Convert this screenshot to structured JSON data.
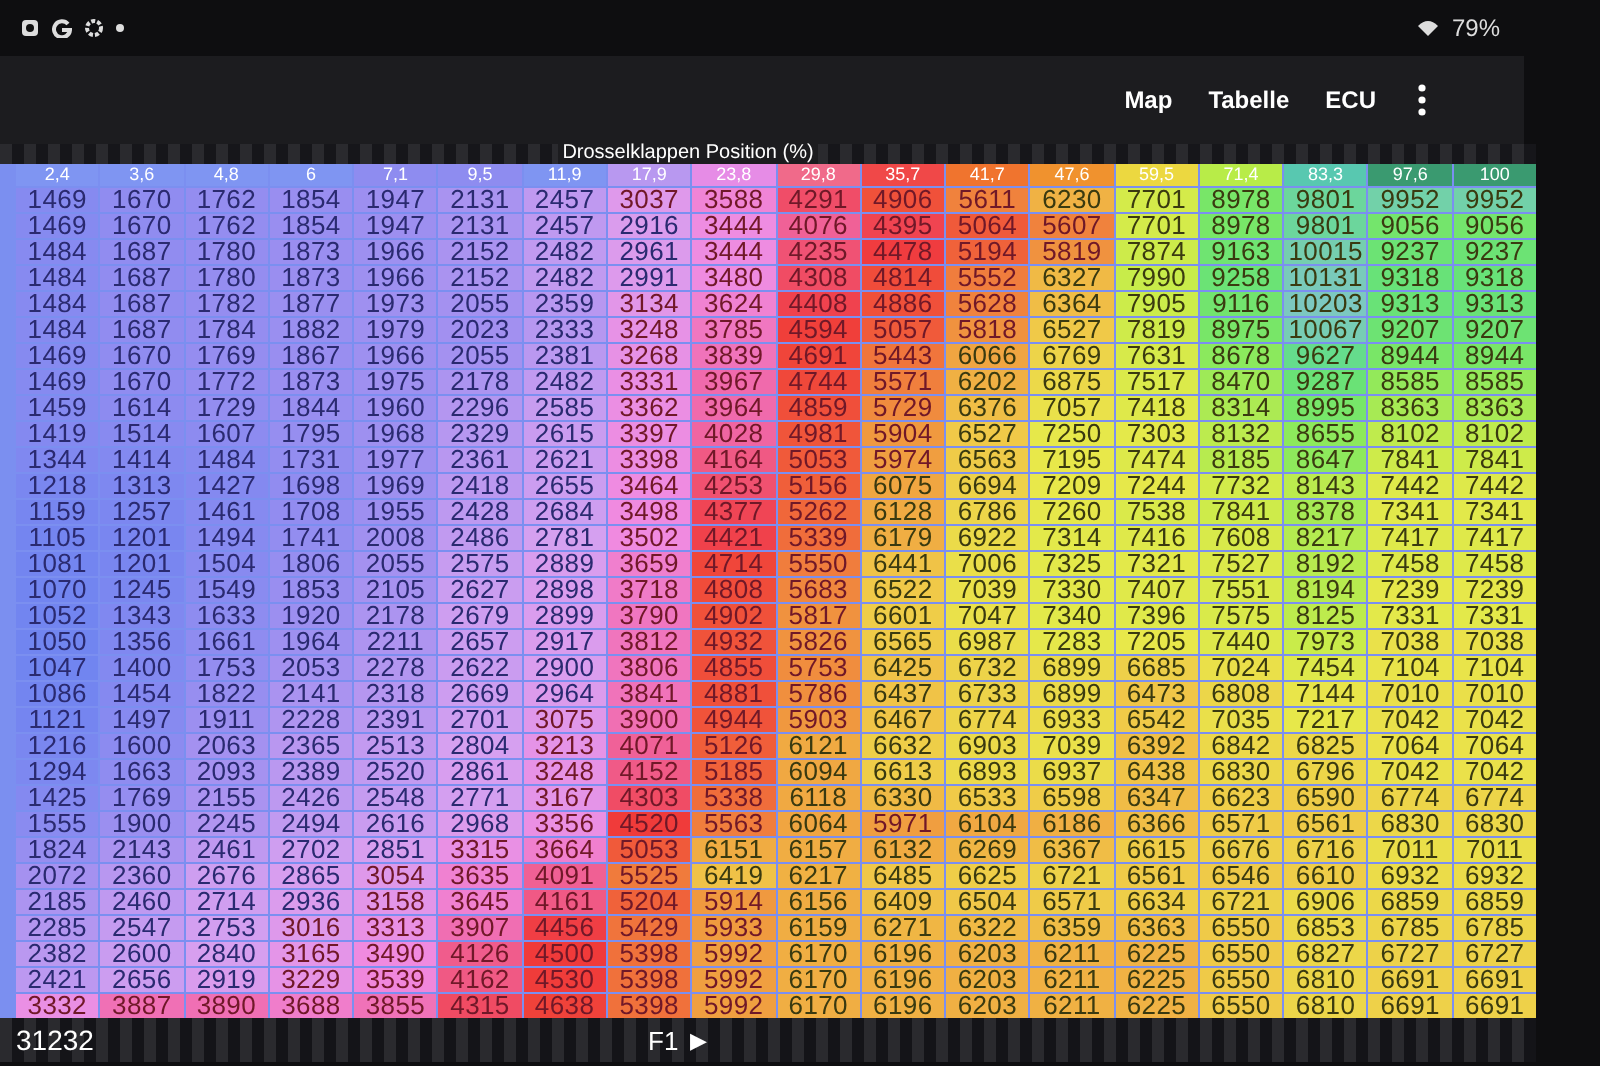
{
  "status_bar": {
    "battery": "79%"
  },
  "app_bar": {
    "actions": [
      "Map",
      "Tabelle",
      "ECU"
    ]
  },
  "table": {
    "title": "Drosselklappen Position (%)",
    "columns": [
      {
        "label": "2,4",
        "color": "#7f95f2"
      },
      {
        "label": "3,6",
        "color": "#7f95f2"
      },
      {
        "label": "4,8",
        "color": "#7f95f2"
      },
      {
        "label": "6",
        "color": "#7f95f2"
      },
      {
        "label": "7,1",
        "color": "#8e8cf0"
      },
      {
        "label": "9,5",
        "color": "#8e8cf0"
      },
      {
        "label": "11,9",
        "color": "#7f95f2"
      },
      {
        "label": "17,9",
        "color": "#b898f0"
      },
      {
        "label": "23,8",
        "color": "#e68ce6"
      },
      {
        "label": "29,8",
        "color": "#f06a8a"
      },
      {
        "label": "35,7",
        "color": "#f04848"
      },
      {
        "label": "41,7",
        "color": "#f0742e"
      },
      {
        "label": "47,6",
        "color": "#f0922e"
      },
      {
        "label": "59,5",
        "color": "#ecd840"
      },
      {
        "label": "71,4",
        "color": "#b8ec48"
      },
      {
        "label": "83,3",
        "color": "#58c8b0"
      },
      {
        "label": "97,6",
        "color": "#3a9a70"
      },
      {
        "label": "100",
        "color": "#3a9a70"
      }
    ],
    "rows": [
      [
        "1469",
        "1670",
        "1762",
        "1854",
        "1947",
        "2131",
        "2457",
        "3037",
        "3588",
        "4291",
        "4906",
        "5611",
        "6230",
        "7701",
        "8978",
        "9801",
        "9952",
        "9952"
      ],
      [
        "1469",
        "1670",
        "1762",
        "1854",
        "1947",
        "2131",
        "2457",
        "2916",
        "3444",
        "4076",
        "4395",
        "5064",
        "5607",
        "7701",
        "8978",
        "9801",
        "9056",
        "9056"
      ],
      [
        "1484",
        "1687",
        "1780",
        "1873",
        "1966",
        "2152",
        "2482",
        "2961",
        "3444",
        "4235",
        "4478",
        "5194",
        "5819",
        "7874",
        "9163",
        "10015",
        "9237",
        "9237"
      ],
      [
        "1484",
        "1687",
        "1780",
        "1873",
        "1966",
        "2152",
        "2482",
        "2991",
        "3480",
        "4308",
        "4814",
        "5552",
        "6327",
        "7990",
        "9258",
        "10131",
        "9318",
        "9318"
      ],
      [
        "1484",
        "1687",
        "1782",
        "1877",
        "1973",
        "2055",
        "2359",
        "3134",
        "3624",
        "4408",
        "4886",
        "5628",
        "6364",
        "7905",
        "9116",
        "10203",
        "9313",
        "9313"
      ],
      [
        "1484",
        "1687",
        "1784",
        "1882",
        "1979",
        "2023",
        "2333",
        "3248",
        "3785",
        "4594",
        "5057",
        "5818",
        "6527",
        "7819",
        "8975",
        "10067",
        "9207",
        "9207"
      ],
      [
        "1469",
        "1670",
        "1769",
        "1867",
        "1966",
        "2055",
        "2381",
        "3268",
        "3839",
        "4691",
        "5443",
        "6066",
        "6769",
        "7631",
        "8678",
        "9627",
        "8944",
        "8944"
      ],
      [
        "1469",
        "1670",
        "1772",
        "1873",
        "1975",
        "2178",
        "2482",
        "3331",
        "3967",
        "4744",
        "5571",
        "6202",
        "6875",
        "7517",
        "8470",
        "9287",
        "8585",
        "8585"
      ],
      [
        "1459",
        "1614",
        "1729",
        "1844",
        "1960",
        "2296",
        "2585",
        "3362",
        "3964",
        "4859",
        "5729",
        "6376",
        "7057",
        "7418",
        "8314",
        "8995",
        "8363",
        "8363"
      ],
      [
        "1419",
        "1514",
        "1607",
        "1795",
        "1968",
        "2329",
        "2615",
        "3397",
        "4028",
        "4981",
        "5904",
        "6527",
        "7250",
        "7303",
        "8132",
        "8655",
        "8102",
        "8102"
      ],
      [
        "1344",
        "1414",
        "1484",
        "1731",
        "1977",
        "2361",
        "2621",
        "3398",
        "4164",
        "5053",
        "5974",
        "6563",
        "7195",
        "7474",
        "8185",
        "8647",
        "7841",
        "7841"
      ],
      [
        "1218",
        "1313",
        "1427",
        "1698",
        "1969",
        "2418",
        "2655",
        "3464",
        "4253",
        "5156",
        "6075",
        "6694",
        "7209",
        "7244",
        "7732",
        "8143",
        "7442",
        "7442"
      ],
      [
        "1159",
        "1257",
        "1461",
        "1708",
        "1955",
        "2428",
        "2684",
        "3498",
        "4377",
        "5262",
        "6128",
        "6786",
        "7260",
        "7538",
        "7841",
        "8378",
        "7341",
        "7341"
      ],
      [
        "1105",
        "1201",
        "1494",
        "1741",
        "2008",
        "2486",
        "2781",
        "3502",
        "4421",
        "5339",
        "6179",
        "6922",
        "7314",
        "7416",
        "7608",
        "8217",
        "7417",
        "7417"
      ],
      [
        "1081",
        "1201",
        "1504",
        "1806",
        "2055",
        "2575",
        "2889",
        "3659",
        "4714",
        "5550",
        "6441",
        "7006",
        "7325",
        "7321",
        "7527",
        "8192",
        "7458",
        "7458"
      ],
      [
        "1070",
        "1245",
        "1549",
        "1853",
        "2105",
        "2627",
        "2898",
        "3718",
        "4808",
        "5683",
        "6522",
        "7039",
        "7330",
        "7407",
        "7551",
        "8194",
        "7239",
        "7239"
      ],
      [
        "1052",
        "1343",
        "1633",
        "1920",
        "2178",
        "2679",
        "2899",
        "3790",
        "4902",
        "5817",
        "6601",
        "7047",
        "7340",
        "7396",
        "7575",
        "8125",
        "7331",
        "7331"
      ],
      [
        "1050",
        "1356",
        "1661",
        "1964",
        "2211",
        "2657",
        "2917",
        "3812",
        "4932",
        "5826",
        "6565",
        "6987",
        "7283",
        "7205",
        "7440",
        "7973",
        "7038",
        "7038"
      ],
      [
        "1047",
        "1400",
        "1753",
        "2053",
        "2278",
        "2622",
        "2900",
        "3806",
        "4855",
        "5753",
        "6425",
        "6732",
        "6899",
        "6685",
        "7024",
        "7454",
        "7104",
        "7104"
      ],
      [
        "1086",
        "1454",
        "1822",
        "2141",
        "2318",
        "2669",
        "2964",
        "3841",
        "4881",
        "5786",
        "6437",
        "6733",
        "6899",
        "6473",
        "6808",
        "7144",
        "7010",
        "7010"
      ],
      [
        "1121",
        "1497",
        "1911",
        "2228",
        "2391",
        "2701",
        "3075",
        "3900",
        "4944",
        "5903",
        "6467",
        "6774",
        "6933",
        "6542",
        "7035",
        "7217",
        "7042",
        "7042"
      ],
      [
        "1216",
        "1600",
        "2063",
        "2365",
        "2513",
        "2804",
        "3213",
        "4071",
        "5126",
        "6121",
        "6632",
        "6903",
        "7039",
        "6392",
        "6842",
        "6825",
        "7064",
        "7064"
      ],
      [
        "1294",
        "1663",
        "2093",
        "2389",
        "2520",
        "2861",
        "3248",
        "4152",
        "5185",
        "6094",
        "6613",
        "6893",
        "6937",
        "6438",
        "6830",
        "6796",
        "7042",
        "7042"
      ],
      [
        "1425",
        "1769",
        "2155",
        "2426",
        "2548",
        "2771",
        "3167",
        "4303",
        "5338",
        "6118",
        "6330",
        "6533",
        "6598",
        "6347",
        "6623",
        "6590",
        "6774",
        "6774"
      ],
      [
        "1555",
        "1900",
        "2245",
        "2494",
        "2616",
        "2968",
        "3356",
        "4520",
        "5563",
        "6064",
        "5971",
        "6104",
        "6186",
        "6366",
        "6571",
        "6561",
        "6830",
        "6830"
      ],
      [
        "1824",
        "2143",
        "2461",
        "2702",
        "2851",
        "3315",
        "3664",
        "5053",
        "6151",
        "6157",
        "6132",
        "6269",
        "6367",
        "6615",
        "6676",
        "6716",
        "7011",
        "7011"
      ],
      [
        "2072",
        "2360",
        "2676",
        "2865",
        "3054",
        "3635",
        "4091",
        "5525",
        "6419",
        "6217",
        "6485",
        "6625",
        "6721",
        "6561",
        "6546",
        "6610",
        "6932",
        "6932"
      ],
      [
        "2185",
        "2460",
        "2714",
        "2936",
        "3158",
        "3645",
        "4161",
        "5204",
        "5914",
        "6156",
        "6409",
        "6504",
        "6571",
        "6634",
        "6721",
        "6906",
        "6859",
        "6859"
      ],
      [
        "2285",
        "2547",
        "2753",
        "3016",
        "3313",
        "3907",
        "4456",
        "5429",
        "5933",
        "6159",
        "6271",
        "6322",
        "6359",
        "6363",
        "6550",
        "6853",
        "6785",
        "6785"
      ],
      [
        "2382",
        "2600",
        "2840",
        "3165",
        "3490",
        "4126",
        "4500",
        "5398",
        "5992",
        "6170",
        "6196",
        "6203",
        "6211",
        "6225",
        "6550",
        "6827",
        "6727",
        "6727"
      ],
      [
        "2421",
        "2656",
        "2919",
        "3229",
        "3539",
        "4162",
        "4530",
        "5398",
        "5992",
        "6170",
        "6196",
        "6203",
        "6211",
        "6225",
        "6550",
        "6810",
        "6691",
        "6691"
      ],
      [
        "3332",
        "3887",
        "3890",
        "3688",
        "3855",
        "4315",
        "4638",
        "5398",
        "5992",
        "6170",
        "6196",
        "6203",
        "6211",
        "6225",
        "6550",
        "6810",
        "6691",
        "6691"
      ]
    ]
  },
  "footer": {
    "value": "31232",
    "page": "F1",
    "arrow": "▶"
  }
}
